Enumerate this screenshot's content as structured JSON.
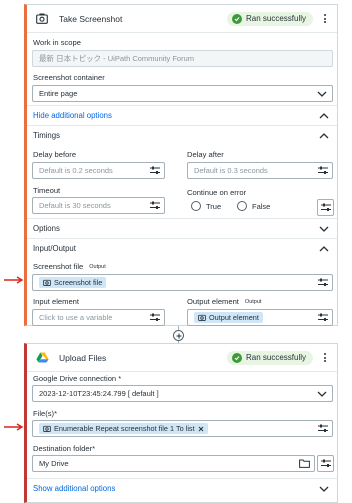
{
  "take_screenshot": {
    "title": "Take Screenshot",
    "status": "Ran successfully",
    "work_in_scope": {
      "label": "Work in scope",
      "value": "最新 日本トピック - UiPath Community Forum"
    },
    "screenshot_container": {
      "label": "Screenshot container",
      "value": "Entire page"
    },
    "hide_options_link": "Hide additional options",
    "timings": {
      "title": "Timings",
      "delay_before": {
        "label": "Delay before",
        "placeholder": "Default is 0.2 seconds"
      },
      "delay_after": {
        "label": "Delay after",
        "placeholder": "Default is 0.3 seconds"
      },
      "timeout": {
        "label": "Timeout",
        "placeholder": "Default is 30 seconds"
      },
      "continue_on_error": {
        "label": "Continue on error",
        "options": [
          "True",
          "False"
        ]
      }
    },
    "options_title": "Options",
    "input_output": {
      "title": "Input/Output",
      "screenshot_file": {
        "label": "Screenshot file",
        "tag": "Output",
        "chip": "Screenshot file"
      },
      "input_element": {
        "label": "Input element",
        "placeholder": "Click to use a variable"
      },
      "output_element": {
        "label": "Output element",
        "tag": "Output",
        "chip": "Output element"
      }
    }
  },
  "upload_files": {
    "title": "Upload Files",
    "status": "Ran successfully",
    "drive_connection": {
      "label": "Google Drive connection *",
      "value": "2023-12-10T23:45:24.799 [ default ]"
    },
    "files": {
      "label": "File(s)*",
      "chip": "Enumerable Repeat screenshot file 1 To list"
    },
    "destination": {
      "label": "Destination folder*",
      "value": "My Drive"
    },
    "show_options_link": "Show additional options"
  },
  "colors": {
    "accent_orange": "#e9703e",
    "accent_red": "#c23934",
    "link_blue": "#0067df",
    "success_green": "#3c9a3a",
    "chip_blue": "#cfe6f7"
  }
}
